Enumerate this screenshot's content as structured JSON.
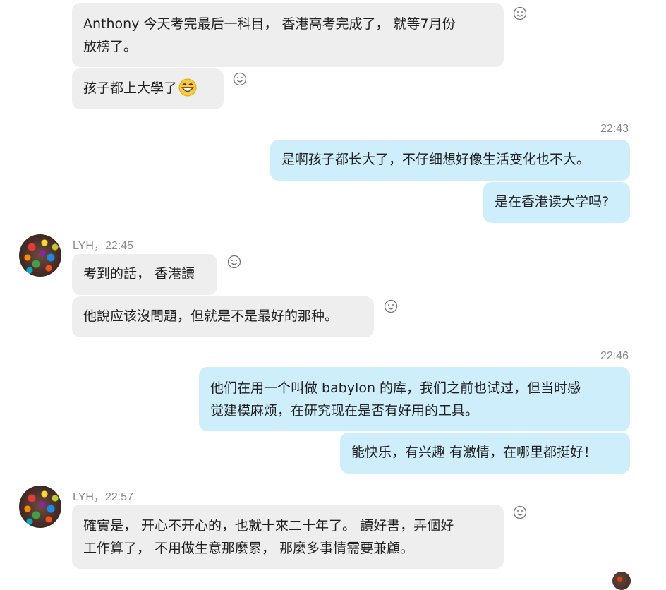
{
  "messages": [
    {
      "id": "m1",
      "text_l1": "Anthony 今天考完最后一科目， 香港高考完成了， 就等7月份",
      "text_l2": "放榜了。"
    },
    {
      "id": "m2",
      "text": "孩子都上大學了",
      "emoji": "grinning-face-emoji"
    },
    {
      "id": "t1",
      "time": "22:43"
    },
    {
      "id": "m3",
      "text": "是啊孩子都长大了，不仔细想好像生活变化也不大。"
    },
    {
      "id": "m4",
      "text": "是在香港读大学吗?"
    },
    {
      "id": "s1",
      "sender": "LYH，22:45"
    },
    {
      "id": "m5",
      "text": "考到的話， 香港讀"
    },
    {
      "id": "m6",
      "text": "他說应该沒問題，但就是不是最好的那种。"
    },
    {
      "id": "t2",
      "time": "22:46"
    },
    {
      "id": "m7",
      "text_l1": "他们在用一个叫做 babylon 的库，我们之前也试过，但当时感",
      "text_l2": "觉建模麻烦，在研究现在是否有好用的工具。"
    },
    {
      "id": "m8",
      "text": "能快乐，有兴趣 有激情，在哪里都挺好！"
    },
    {
      "id": "s2",
      "sender": "LYH，22:57"
    },
    {
      "id": "m9",
      "text_l1": "確實是， 开心不开心的，也就十來二十年了。 讀好書，弄個好",
      "text_l2": "工作算了， 不用做生意那麼累， 那麼多事情需要兼顧。"
    }
  ],
  "icons": {
    "reaction": "smiley-reaction-icon",
    "avatar": "lyh-avatar"
  },
  "colors": {
    "incoming_bubble": "#eeeeee",
    "outgoing_bubble": "#cdeefa",
    "meta_text": "#8a8a8a"
  }
}
